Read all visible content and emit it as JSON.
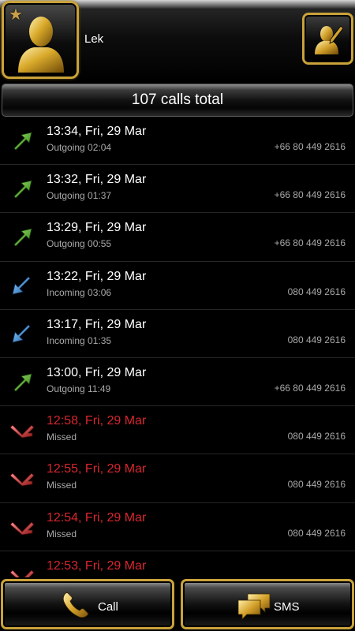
{
  "contact": {
    "name": "Lek"
  },
  "summary": {
    "total_label": "107 calls total"
  },
  "calls": [
    {
      "type": "outgoing",
      "time": "13:34, Fri, 29 Mar",
      "detail": "Outgoing 02:04",
      "number": "+66 80 449 2616",
      "icon": "outgoing-arrow-icon"
    },
    {
      "type": "outgoing",
      "time": "13:32, Fri, 29 Mar",
      "detail": "Outgoing 01:37",
      "number": "+66 80 449 2616",
      "icon": "outgoing-arrow-icon"
    },
    {
      "type": "outgoing",
      "time": "13:29, Fri, 29 Mar",
      "detail": "Outgoing 00:55",
      "number": "+66 80 449 2616",
      "icon": "outgoing-arrow-icon"
    },
    {
      "type": "incoming",
      "time": "13:22, Fri, 29 Mar",
      "detail": "Incoming 03:06",
      "number": "080 449 2616",
      "icon": "incoming-arrow-icon"
    },
    {
      "type": "incoming",
      "time": "13:17, Fri, 29 Mar",
      "detail": "Incoming 01:35",
      "number": "080 449 2616",
      "icon": "incoming-arrow-icon"
    },
    {
      "type": "outgoing",
      "time": "13:00, Fri, 29 Mar",
      "detail": "Outgoing 11:49",
      "number": "+66 80 449 2616",
      "icon": "outgoing-arrow-icon"
    },
    {
      "type": "missed",
      "time": "12:58, Fri, 29 Mar",
      "detail": "Missed",
      "number": "080 449 2616",
      "icon": "missed-call-icon"
    },
    {
      "type": "missed",
      "time": "12:55, Fri, 29 Mar",
      "detail": "Missed",
      "number": "080 449 2616",
      "icon": "missed-call-icon"
    },
    {
      "type": "missed",
      "time": "12:54, Fri, 29 Mar",
      "detail": "Missed",
      "number": "080 449 2616",
      "icon": "missed-call-icon"
    },
    {
      "type": "missed",
      "time": "12:53, Fri, 29 Mar",
      "detail": "",
      "number": "",
      "icon": "missed-call-icon"
    }
  ],
  "actions": {
    "call_label": "Call",
    "sms_label": "SMS"
  },
  "colors": {
    "accent_gold": "#c9a23a",
    "missed_red": "#d8262e",
    "outgoing_green": "#4cae2a",
    "incoming_blue": "#3a8fd6",
    "secondary_text": "#a8a8a8"
  }
}
